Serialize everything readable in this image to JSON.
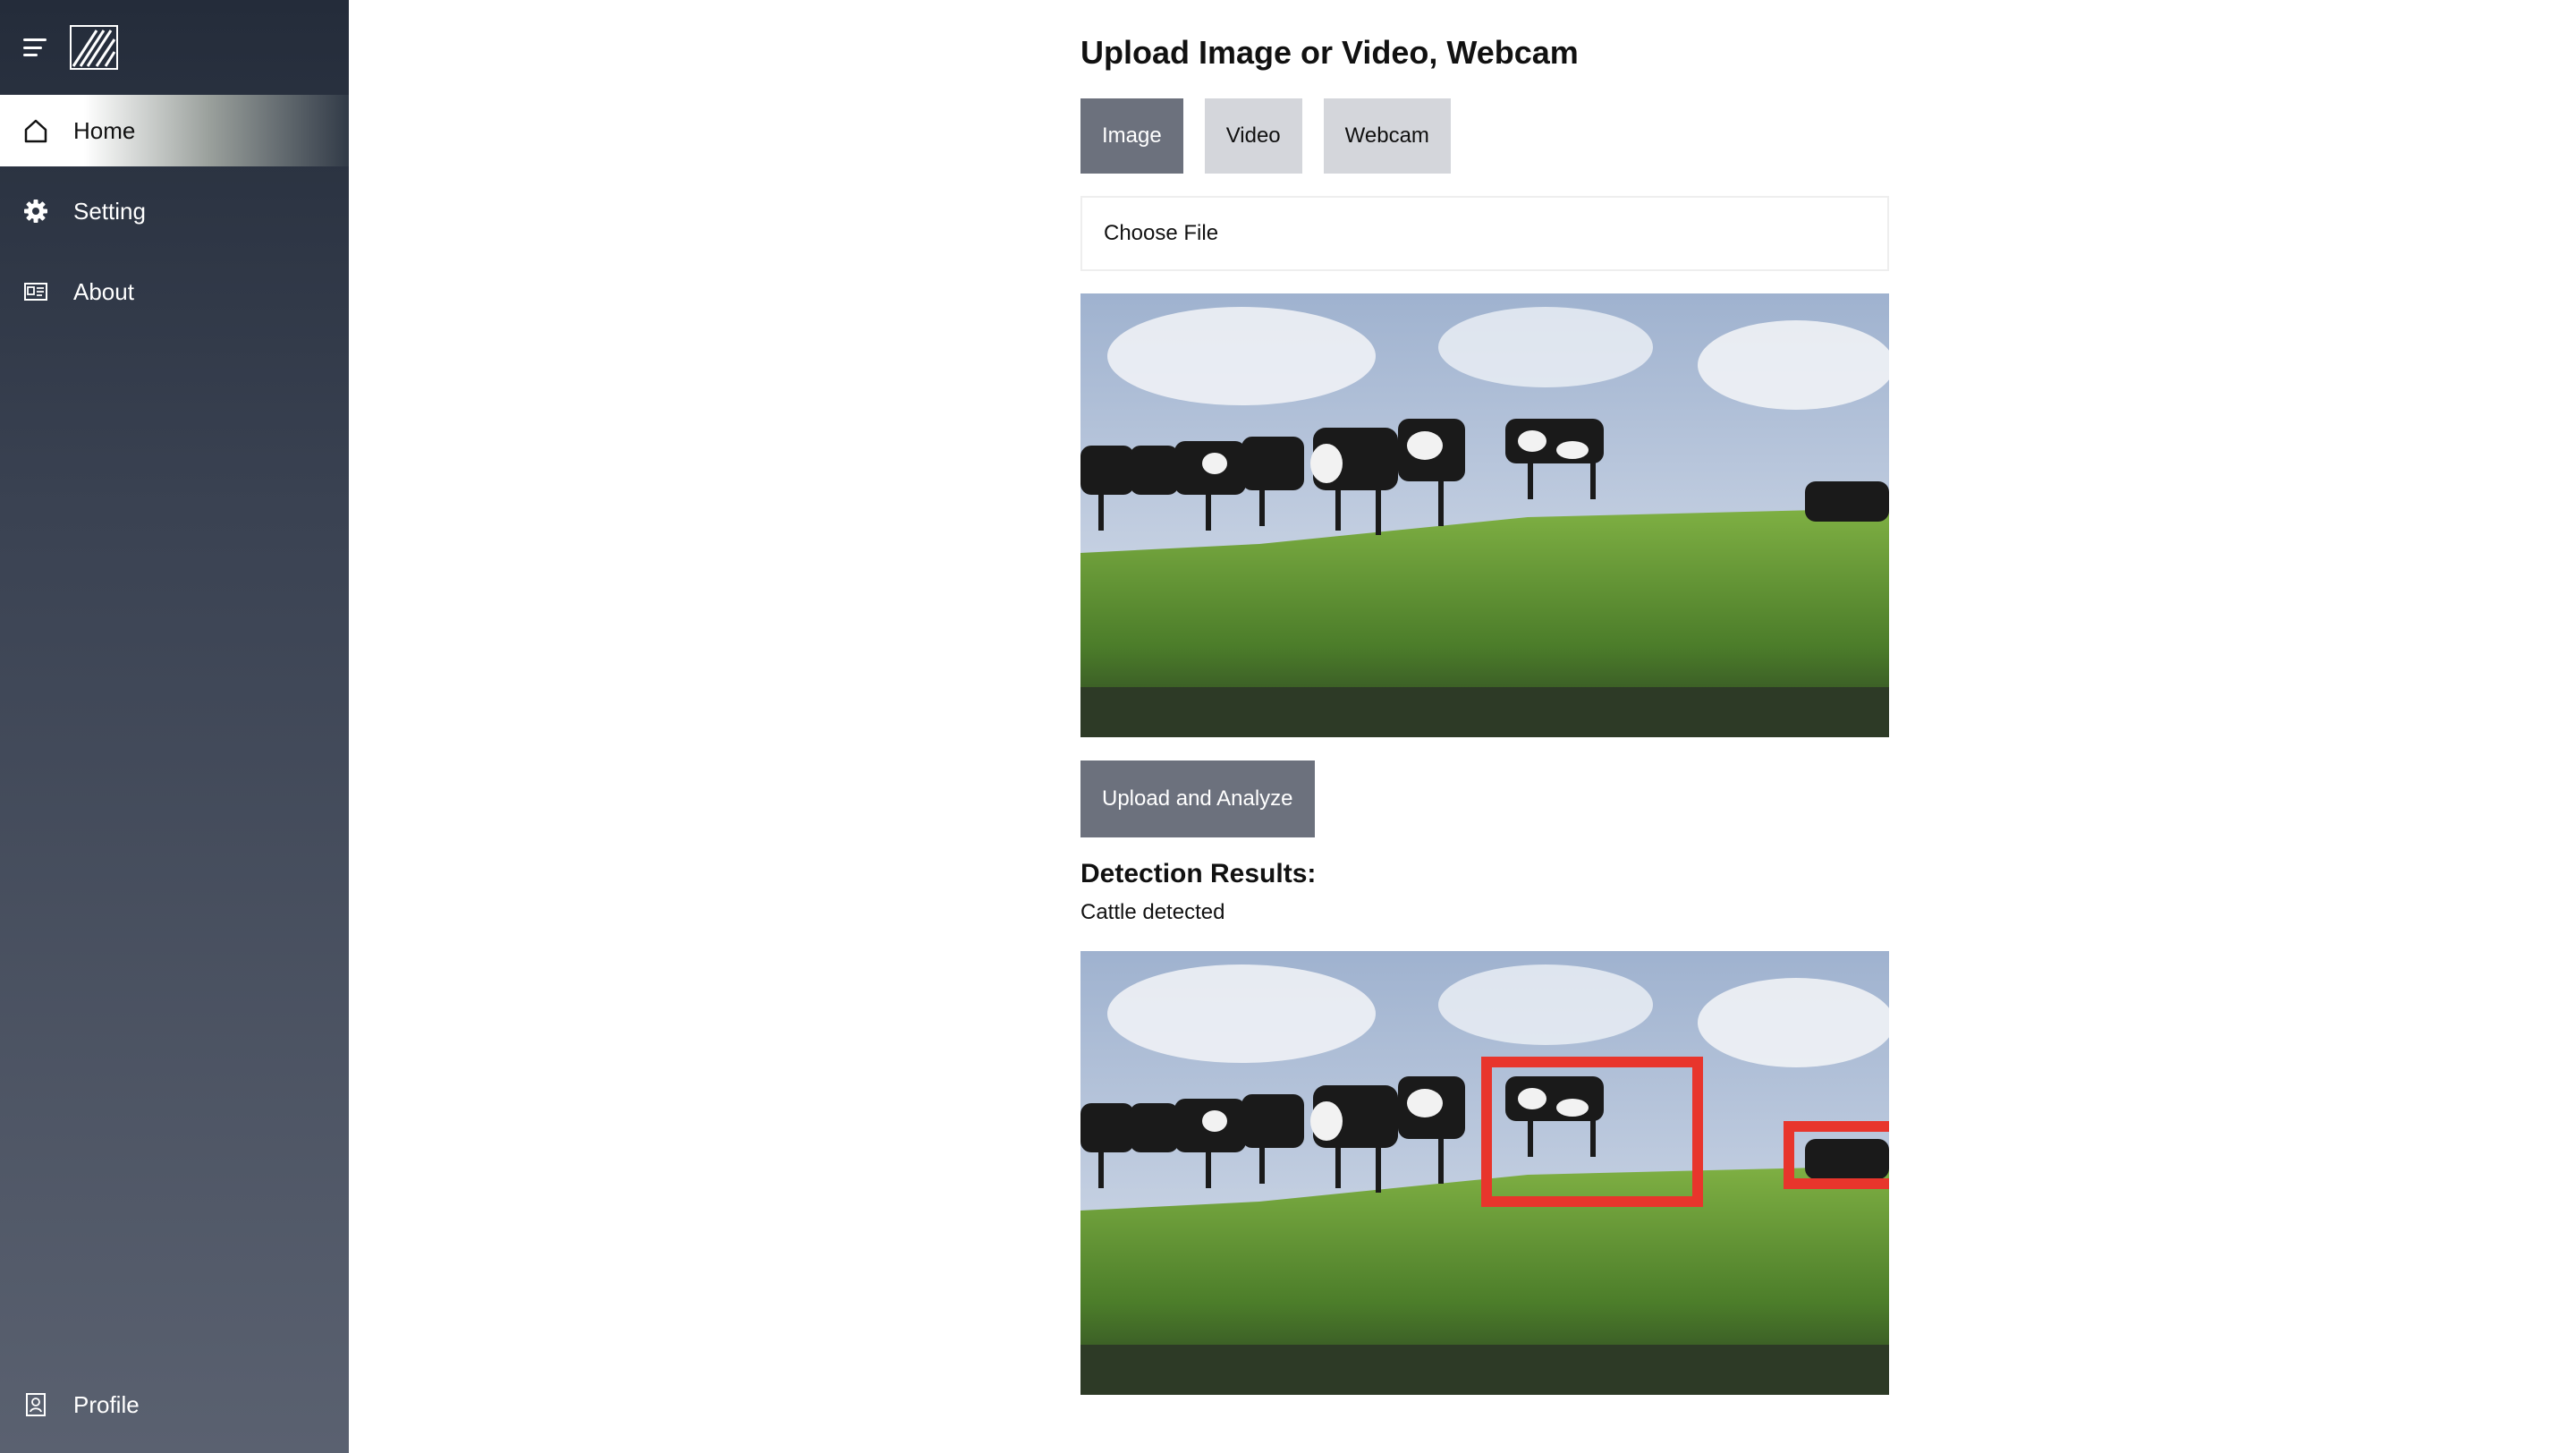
{
  "sidebar": {
    "menu_icon": "hamburger-menu-icon",
    "logo_icon": "app-logo-icon",
    "items": [
      {
        "label": "Home",
        "icon": "home-icon",
        "active": true
      },
      {
        "label": "Setting",
        "icon": "gear-icon",
        "active": false
      },
      {
        "label": "About",
        "icon": "id-card-icon",
        "active": false
      }
    ],
    "profile": {
      "label": "Profile",
      "icon": "profile-icon"
    }
  },
  "main": {
    "title": "Upload Image or Video, Webcam",
    "tabs": [
      {
        "label": "Image",
        "active": true
      },
      {
        "label": "Video",
        "active": false
      },
      {
        "label": "Webcam",
        "active": false
      }
    ],
    "file_input_label": "Choose File",
    "upload_button_label": "Upload and Analyze",
    "results_title": "Detection Results:",
    "results_text": "Cattle detected"
  },
  "colors": {
    "sidebar_dark": "#242c3a",
    "button_active": "#6c717d",
    "button_inactive": "#d4d6db",
    "detection_box": "#e8352c"
  }
}
